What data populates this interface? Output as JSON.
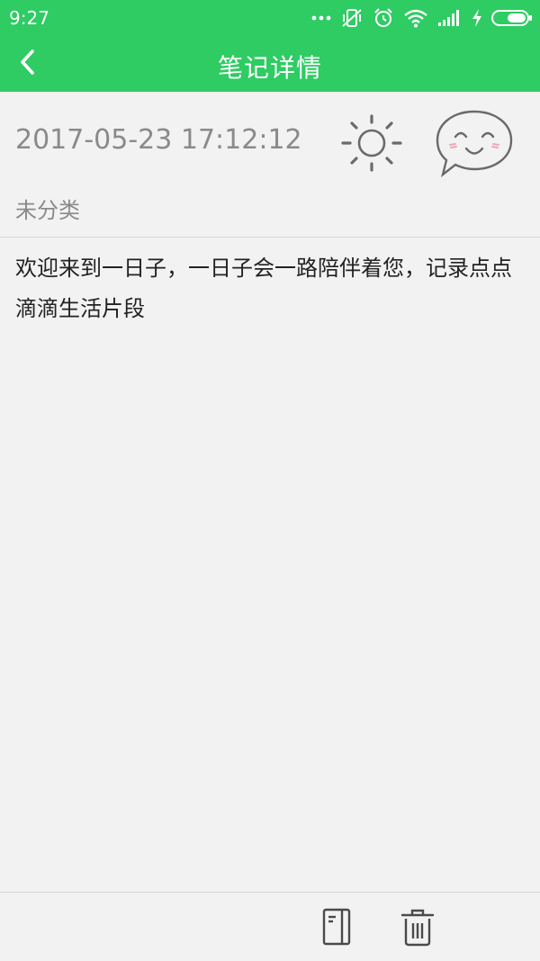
{
  "statusbar": {
    "time": "9:27",
    "icons": [
      "more-dots-icon",
      "vibrate-off-icon",
      "alarm-icon",
      "wifi-icon",
      "signal-icon",
      "charging-icon",
      "battery-icon"
    ]
  },
  "header": {
    "title": "笔记详情",
    "back_icon": "chevron-left-icon"
  },
  "note": {
    "datetime": "2017-05-23 17:12:12",
    "weather_icon": "sun-icon",
    "mood_icon": "smiley-bubble-icon",
    "category": "未分类",
    "content": "欢迎来到一日子，一日子会一路陪伴着您，记录点点滴滴生活片段"
  },
  "toolbar": {
    "notebook_icon": "notebook-icon",
    "delete_icon": "trash-icon"
  },
  "colors": {
    "primary": "#2ecc63",
    "background": "#f2f2f2",
    "secondary_text": "#8a8a8a",
    "body_text": "#222222"
  }
}
